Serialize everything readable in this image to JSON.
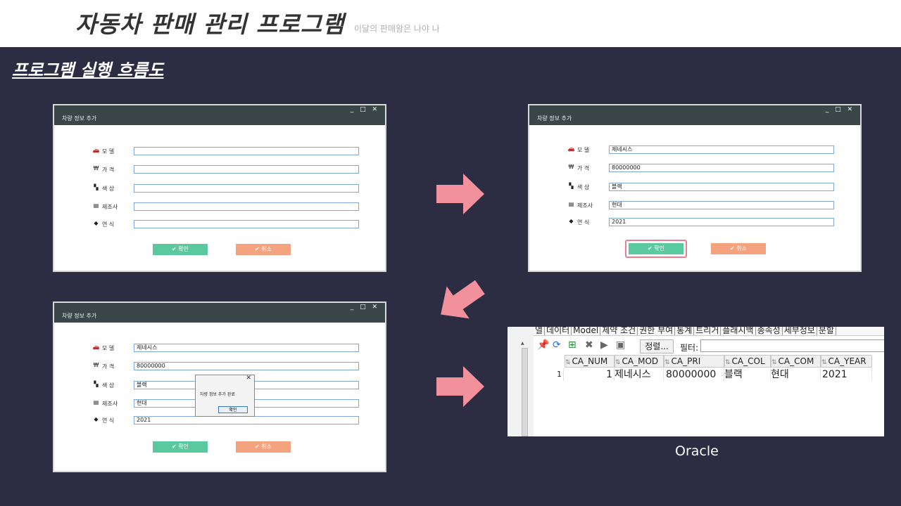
{
  "slide": {
    "title": "자동차 판매 관리 프로그램",
    "subtitle": "이달의 판매왕은 나야 나",
    "section_title": "프로그램 실행 흐름도",
    "oracle_caption": "Oracle"
  },
  "form": {
    "window_title": "차량 정보 추가",
    "window_controls": "_ □ ✕",
    "labels": {
      "model": "모 델",
      "price": "가 격",
      "color": "색 상",
      "company": "제조사",
      "year": "연 식"
    },
    "ok_label": "확인",
    "cancel_label": "취소"
  },
  "windows": {
    "empty": {
      "model": "",
      "price": "",
      "color": "",
      "company": "",
      "year": ""
    },
    "filled": {
      "model": "제네시스",
      "price": "80000000",
      "color": "블랙",
      "company": "현대",
      "year": "2021"
    },
    "done": {
      "model": "제네시스",
      "price": "80000000",
      "color": "블랙",
      "company": "현대",
      "year": "2021"
    }
  },
  "dialog": {
    "close": "✕",
    "message": "차량 정보 추가 완료",
    "ok_label": "확인"
  },
  "oracle": {
    "tabs": [
      "열",
      "데이터",
      "Model",
      "제약 조건",
      "권한 부여",
      "통계",
      "트리거",
      "플래시백",
      "종속성",
      "세부정보",
      "분할"
    ],
    "sort_label": "정렬...",
    "filter_label": "필터:",
    "filter_value": "",
    "columns": [
      "CA_NUM",
      "CA_MOD",
      "CA_PRI",
      "CA_COL",
      "CA_COM",
      "CA_YEAR"
    ],
    "row": {
      "index": "1",
      "num": "1",
      "model": "제네시스",
      "price": "80000000",
      "color": "블랙",
      "company": "현대",
      "year": "2021"
    }
  },
  "colors": {
    "background": "#2c2c42",
    "arrow": "#f2909c",
    "ok_button": "#5bc9a0",
    "cancel_button": "#f5a27e",
    "titlebar": "#3a4648"
  },
  "icons": {
    "model": "car-icon",
    "price": "won-icon",
    "color": "checker-icon",
    "company": "id-card-icon",
    "year": "tag-icon",
    "ok": "check-icon",
    "cancel": "check-icon"
  }
}
